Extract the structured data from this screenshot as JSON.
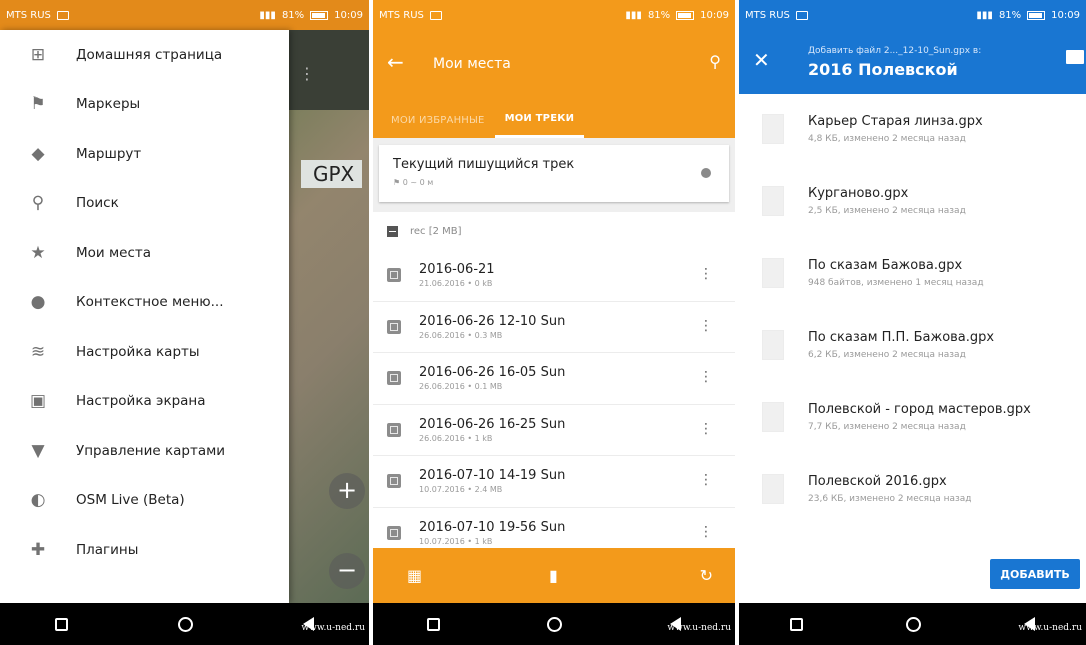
{
  "screens": {
    "s1": {
      "status": {
        "carrier": "MTS RUS",
        "battery": "81%",
        "time": "10:09"
      },
      "map_label": "GPX",
      "map_zoom_in": "+",
      "map_zoom_out": "−",
      "map_menu_dots": "⋮",
      "drawer": [
        {
          "label": "Домашняя страница",
          "icon": "home-grid-icon",
          "glyph": "⊞"
        },
        {
          "label": "Маркеры",
          "icon": "flag-icon",
          "glyph": "⚑"
        },
        {
          "label": "Маршрут",
          "icon": "route-diamond-icon",
          "glyph": "◆"
        },
        {
          "label": "Поиск",
          "icon": "search-icon",
          "glyph": "⚲"
        },
        {
          "label": "Мои места",
          "icon": "star-icon",
          "glyph": "★"
        },
        {
          "label": "Контекстное меню...",
          "icon": "location-pin-icon",
          "glyph": "●"
        },
        {
          "label": "Настройка карты",
          "icon": "layers-icon",
          "glyph": "≋"
        },
        {
          "label": "Настройка экрана",
          "icon": "screen-settings-icon",
          "glyph": "▣"
        },
        {
          "label": "Управление картами",
          "icon": "download-icon",
          "glyph": "▼"
        },
        {
          "label": "OSM Live (Beta)",
          "icon": "globe-icon",
          "glyph": "◐"
        },
        {
          "label": "Плагины",
          "icon": "puzzle-icon",
          "glyph": "✚"
        }
      ]
    },
    "s2": {
      "status": {
        "carrier": "MTS RUS",
        "battery": "81%",
        "time": "10:09"
      },
      "title": "Мои места",
      "tabs": [
        "МОИ ИЗБРАННЫЕ",
        "МОИ ТРЕКИ"
      ],
      "current_track": {
        "title": "Текущий пишущийся трек",
        "meta": "⚑ 0 ~ 0 м"
      },
      "folder": "rec [2 MB]",
      "tracks": [
        {
          "name": "2016-06-21",
          "meta": "21.06.2016 • 0 kB"
        },
        {
          "name": "2016-06-26 12-10 Sun",
          "meta": "26.06.2016 • 0.3 MB"
        },
        {
          "name": "2016-06-26 16-05 Sun",
          "meta": "26.06.2016 • 0.1 MB"
        },
        {
          "name": "2016-06-26 16-25 Sun",
          "meta": "26.06.2016 • 1 kB"
        },
        {
          "name": "2016-07-10 14-19 Sun",
          "meta": "10.07.2016 • 2.4 MB"
        },
        {
          "name": "2016-07-10 19-56 Sun",
          "meta": "10.07.2016 • 1 kB"
        }
      ]
    },
    "s3": {
      "status": {
        "carrier": "MTS RUS",
        "battery": "81%",
        "time": "10:09"
      },
      "subtitle": "Добавить файл 2..._12-10_Sun.gpx в:",
      "title": "2016 Полевской",
      "files": [
        {
          "name": "Карьер Старая линза.gpx",
          "meta": "4,8 КБ, изменено 2 месяца назад"
        },
        {
          "name": "Курганово.gpx",
          "meta": "2,5 КБ, изменено 2 месяца назад"
        },
        {
          "name": "По сказам Бажова.gpx",
          "meta": "948 байтов, изменено 1 месяц назад"
        },
        {
          "name": "По сказам П.П. Бажова.gpx",
          "meta": "6,2 КБ, изменено 2 месяца назад"
        },
        {
          "name": "Полевской - город мастеров.gpx",
          "meta": "7,7 КБ, изменено 2 месяца назад"
        },
        {
          "name": "Полевской 2016.gpx",
          "meta": "23,6 КБ, изменено 2 месяца назад"
        }
      ],
      "add_button": "ДОБАВИТЬ"
    },
    "watermark": "www.u-ned.ru"
  },
  "colors": {
    "osmand_orange": "#f39a1b",
    "status_orange": "#e38a1a",
    "files_blue": "#1976d2",
    "nav_black": "#000000"
  }
}
